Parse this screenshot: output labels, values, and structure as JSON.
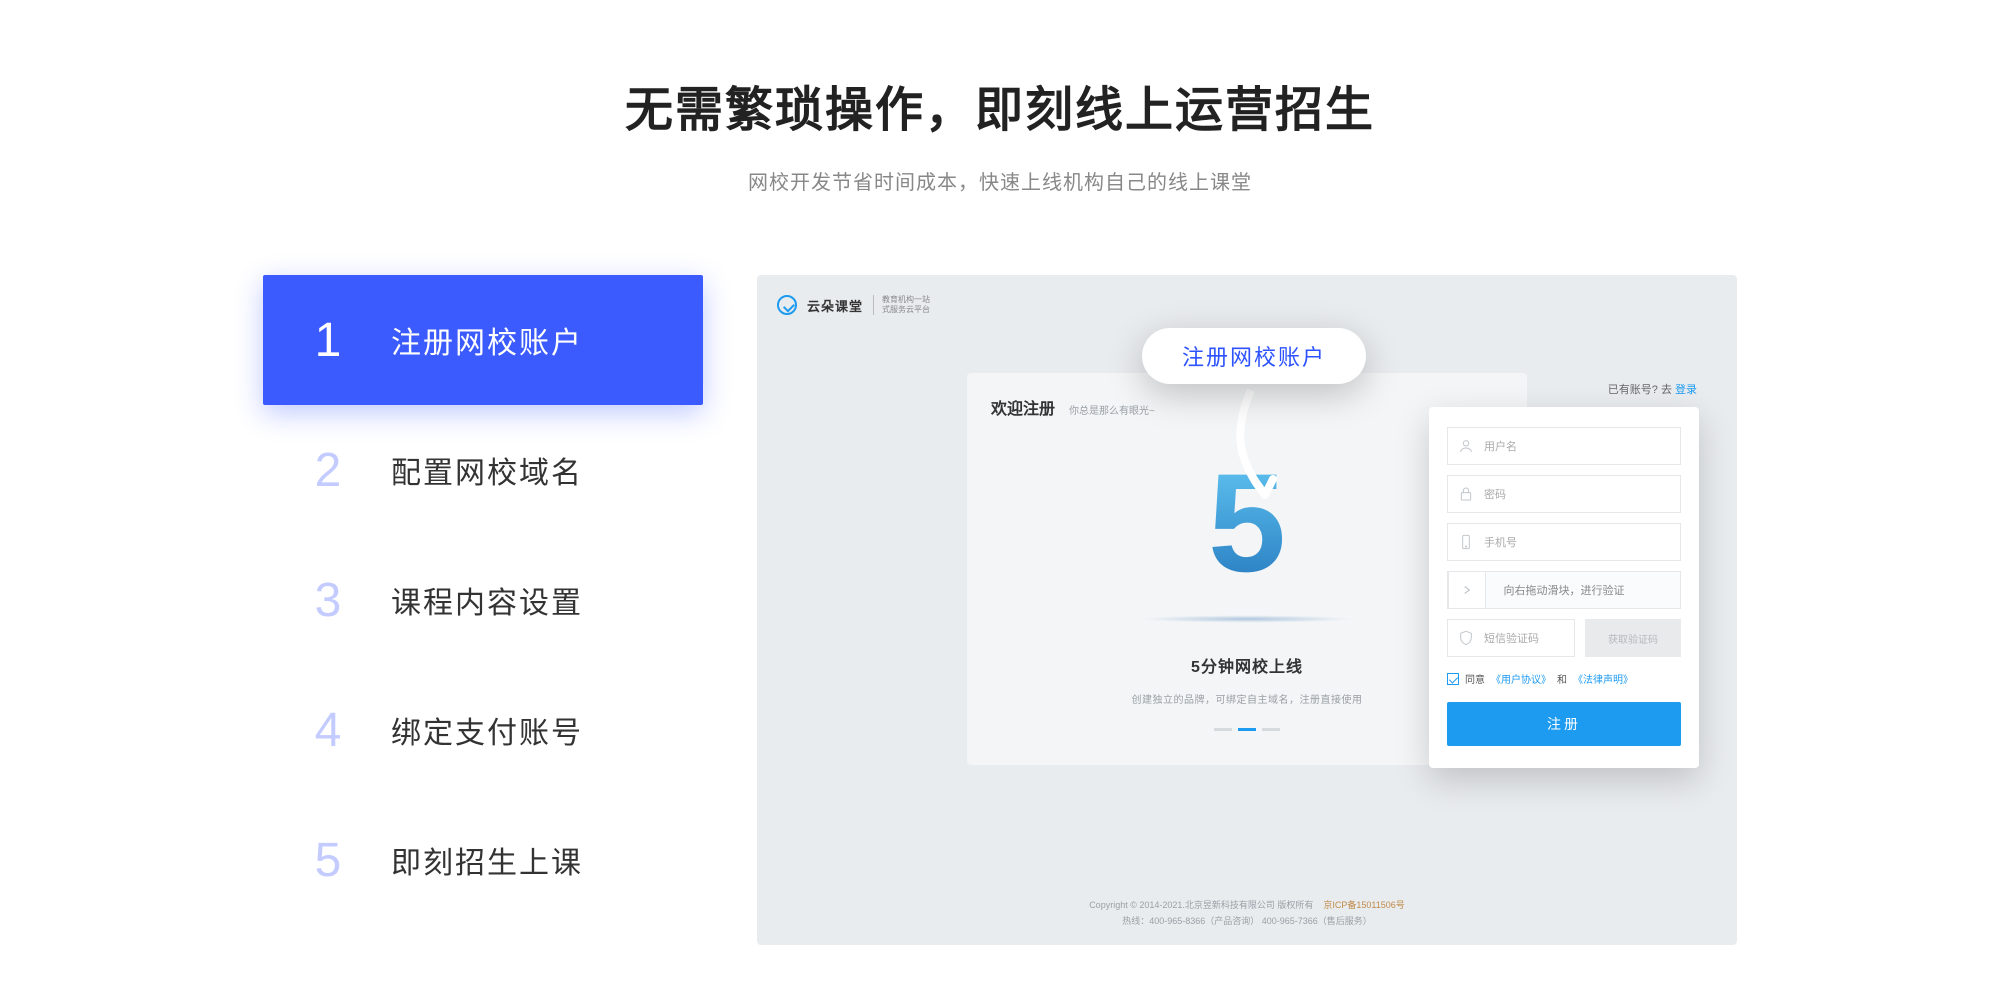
{
  "colors": {
    "accent_primary": "#3b5bff",
    "accent_secondary": "#1d9bf0"
  },
  "headline": {
    "title": "无需繁琐操作，即刻线上运营招生",
    "subtitle": "网校开发节省时间成本，快速上线机构自己的线上课堂"
  },
  "steps": [
    {
      "num": "1",
      "label": "注册网校账户",
      "active": true
    },
    {
      "num": "2",
      "label": "配置网校域名",
      "active": false
    },
    {
      "num": "3",
      "label": "课程内容设置",
      "active": false
    },
    {
      "num": "4",
      "label": "绑定支付账号",
      "active": false
    },
    {
      "num": "5",
      "label": "即刻招生上课",
      "active": false
    }
  ],
  "annotation": {
    "label": "注册网校账户"
  },
  "preview": {
    "logo": {
      "brand": "云朵课堂",
      "sub_line1": "教育机构一站",
      "sub_line2": "式服务云平台"
    },
    "top_right": {
      "prefix": "已有账号? 去 ",
      "login": "登录"
    },
    "center_card": {
      "welcome": "欢迎注册",
      "tagline": "你总是那么有眼光~",
      "hero_digit": "5",
      "caption1": "5分钟网校上线",
      "caption2": "创建独立的品牌，可绑定自主域名，注册直接使用"
    },
    "register_form": {
      "username_ph": "用户名",
      "password_ph": "密码",
      "phone_ph": "手机号",
      "slider_text": "向右拖动滑块，进行验证",
      "sms_ph": "短信验证码",
      "get_code": "获取验证码",
      "agree_text": "同意",
      "user_agreement": "《用户协议》",
      "and_text": "和",
      "legal_statement": "《法律声明》",
      "submit": "注册"
    },
    "footer": {
      "line1_left": "Copyright © 2014-2021.北京昱新科技有限公司 版权所有",
      "line1_icp": "京ICP备15011506号",
      "line2": "热线：400-965-8366（产品咨询）  400-965-7366（售后服务）"
    }
  }
}
